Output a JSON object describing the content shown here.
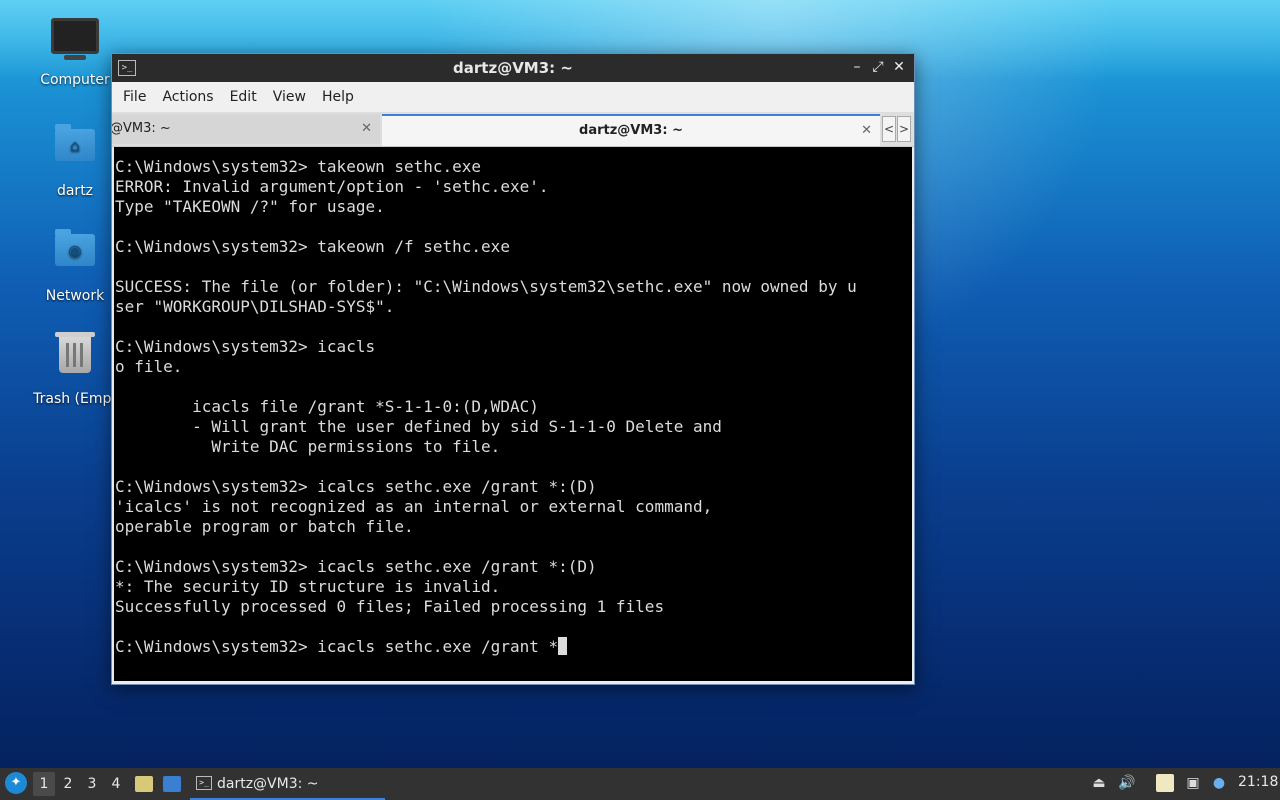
{
  "desktop": {
    "icons": [
      {
        "label": "Computer",
        "icon": "computer-icon"
      },
      {
        "label": "dartz",
        "icon": "home-folder-icon"
      },
      {
        "label": "Network",
        "icon": "network-folder-icon"
      },
      {
        "label": "Trash (Empt",
        "icon": "trash-icon"
      }
    ]
  },
  "window": {
    "title": "dartz@VM3: ~",
    "minimize": "–",
    "maximize": "⤢",
    "close": "✕",
    "menu": [
      "File",
      "Actions",
      "Edit",
      "View",
      "Help"
    ],
    "tabs": [
      {
        "label": "@VM3: ~",
        "close": "✕"
      },
      {
        "label": "dartz@VM3: ~",
        "close": "✕"
      }
    ],
    "tab_scroll_left": "<",
    "tab_scroll_right": ">",
    "terminal": {
      "lines": [
        "C:\\Windows\\system32> takeown sethc.exe",
        "ERROR: Invalid argument/option - 'sethc.exe'.",
        "Type \"TAKEOWN /?\" for usage.",
        "",
        "C:\\Windows\\system32> takeown /f sethc.exe",
        "",
        "SUCCESS: The file (or folder): \"C:\\Windows\\system32\\sethc.exe\" now owned by u",
        "ser \"WORKGROUP\\DILSHAD-SYS$\".",
        "",
        "C:\\Windows\\system32> icacls",
        "o file.",
        "",
        "        icacls file /grant *S-1-1-0:(D,WDAC)",
        "        - Will grant the user defined by sid S-1-1-0 Delete and",
        "          Write DAC permissions to file.",
        "",
        "C:\\Windows\\system32> icalcs sethc.exe /grant *:(D)",
        "'icalcs' is not recognized as an internal or external command,",
        "operable program or batch file.",
        "",
        "C:\\Windows\\system32> icacls sethc.exe /grant *:(D)",
        "*: The security ID structure is invalid.",
        "Successfully processed 0 files; Failed processing 1 files",
        ""
      ],
      "current_input": "C:\\Windows\\system32> icacls sethc.exe /grant *"
    }
  },
  "taskbar": {
    "workspaces": [
      "1",
      "2",
      "3",
      "4"
    ],
    "active_workspace": "1",
    "task_label": "dartz@VM3: ~",
    "clock": "21:18"
  }
}
